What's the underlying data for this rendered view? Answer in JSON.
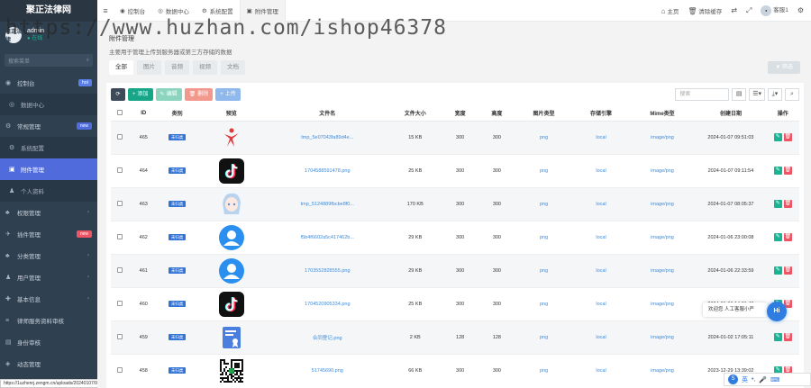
{
  "sidebar": {
    "brand": "聚正法律网",
    "user": {
      "avatar": "聚正法律",
      "name": "admin",
      "status": "在线"
    },
    "search_placeholder": "搜索菜单",
    "items": [
      {
        "label": "控制台",
        "icon": "dashboard-icon",
        "badge": "hot",
        "badge_color": "#5b7fe8"
      },
      {
        "label": "数据中心",
        "icon": "chart-icon",
        "sub": true
      },
      {
        "label": "常规管理",
        "icon": "gear-icon",
        "badge": "new",
        "badge_color": "#4f6bdc"
      },
      {
        "label": "系统配置",
        "icon": "cog-icon",
        "sub": true
      },
      {
        "label": "附件管理",
        "icon": "file-icon",
        "sub": true,
        "active": true
      },
      {
        "label": "个人资料",
        "icon": "user-icon",
        "sub": true
      },
      {
        "label": "权限管理",
        "icon": "group-icon",
        "arrow": true
      },
      {
        "label": "插件管理",
        "icon": "rocket-icon",
        "badge": "new",
        "badge_color": "#ed5565"
      },
      {
        "label": "分类管理",
        "icon": "leaf-icon",
        "arrow": true
      },
      {
        "label": "用户管理",
        "icon": "users-icon",
        "arrow": true
      },
      {
        "label": "基本信息",
        "icon": "info-icon",
        "arrow": true
      },
      {
        "label": "律师服务资料审核",
        "icon": "list-icon"
      },
      {
        "label": "身份审核",
        "icon": "id-icon"
      },
      {
        "label": "动态管理",
        "icon": "feed-icon"
      }
    ]
  },
  "statusbar": "https://1uzhenrj.zengm.cn/uploads/20240107/93ce1d930fc7f64b707cd29d46d8ea11.png",
  "topbar": {
    "tabs": [
      {
        "label": "控制台",
        "icon": "dashboard-icon"
      },
      {
        "label": "数据中心",
        "icon": "chart-icon"
      },
      {
        "label": "系统配置",
        "icon": "cog-icon"
      },
      {
        "label": "附件管理",
        "icon": "file-icon",
        "active": true
      }
    ],
    "home": "主页",
    "clear_cache": "清除缓存",
    "user": "客服1"
  },
  "panel": {
    "title": "附件管理",
    "subtitle": "主要用于管理上传到服务器或第三方存储的数据",
    "tabs": [
      "全部",
      "图片",
      "音频",
      "视频",
      "文档"
    ],
    "filter_btn": "筛选",
    "toolbar": {
      "add": "添加",
      "edit": "编辑",
      "delete": "删除",
      "upload": "上传"
    },
    "search_placeholder": "搜索"
  },
  "table": {
    "headers": [
      "ID",
      "类别",
      "预览",
      "文件名",
      "文件大小",
      "宽度",
      "高度",
      "图片类型",
      "存储引擎",
      "Mime类型",
      "创建日期",
      "操作"
    ],
    "rows": [
      {
        "id": "465",
        "category": "未归类",
        "thumb": "dancer",
        "filename": "tmp_5e07043fa89d4e...",
        "size": "15 KB",
        "w": "300",
        "h": "300",
        "type": "png",
        "storage": "local",
        "mime": "image/png",
        "date": "2024-01-07 09:51:03"
      },
      {
        "id": "464",
        "category": "未归类",
        "thumb": "tiktok",
        "filename": "1704588591478.png",
        "size": "25 KB",
        "w": "300",
        "h": "300",
        "type": "png",
        "storage": "local",
        "mime": "image/png",
        "date": "2024-01-07 09:11:54"
      },
      {
        "id": "463",
        "category": "未归类",
        "thumb": "anime",
        "filename": "tmp_5124889fbcbe8f0...",
        "size": "170 KB",
        "w": "300",
        "h": "300",
        "type": "png",
        "storage": "local",
        "mime": "image/png",
        "date": "2024-01-07 08:05:37"
      },
      {
        "id": "462",
        "category": "未归类",
        "thumb": "person",
        "filename": "f5b4f6602a5c417462b...",
        "size": "29 KB",
        "w": "300",
        "h": "300",
        "type": "png",
        "storage": "local",
        "mime": "image/png",
        "date": "2024-01-06 23:00:08"
      },
      {
        "id": "461",
        "category": "未归类",
        "thumb": "person",
        "filename": "1703552828555.png",
        "size": "29 KB",
        "w": "300",
        "h": "300",
        "type": "png",
        "storage": "local",
        "mime": "image/png",
        "date": "2024-01-06 22:33:59"
      },
      {
        "id": "460",
        "category": "未归类",
        "thumb": "tiktok",
        "filename": "1704520905334.png",
        "size": "25 KB",
        "w": "300",
        "h": "300",
        "type": "png",
        "storage": "local",
        "mime": "image/png",
        "date": "2024-01-06 14:01:43"
      },
      {
        "id": "459",
        "category": "未归类",
        "thumb": "cert",
        "filename": "合同登记.png",
        "size": "2 KB",
        "w": "128",
        "h": "128",
        "type": "png",
        "storage": "local",
        "mime": "image/png",
        "date": "2024-01-02 17:05:11"
      },
      {
        "id": "458",
        "category": "未归类",
        "thumb": "qr",
        "filename": "51745690.png",
        "size": "66 KB",
        "w": "300",
        "h": "300",
        "type": "png",
        "storage": "local",
        "mime": "image/png",
        "date": "2023-12-29 13:39:02"
      }
    ]
  },
  "chat": {
    "bubble": "欢迎您 人工客服小严",
    "button": "Hi"
  },
  "ime": {
    "logo": "S",
    "lang": "英"
  },
  "watermark": "https://www.huzhan.com/ishop46378",
  "colors": {
    "sidebar_bg": "#2f4050",
    "active_menu": "#4f6bdc",
    "link": "#3c8dde",
    "edit": "#1ab394",
    "delete": "#ed5565"
  }
}
